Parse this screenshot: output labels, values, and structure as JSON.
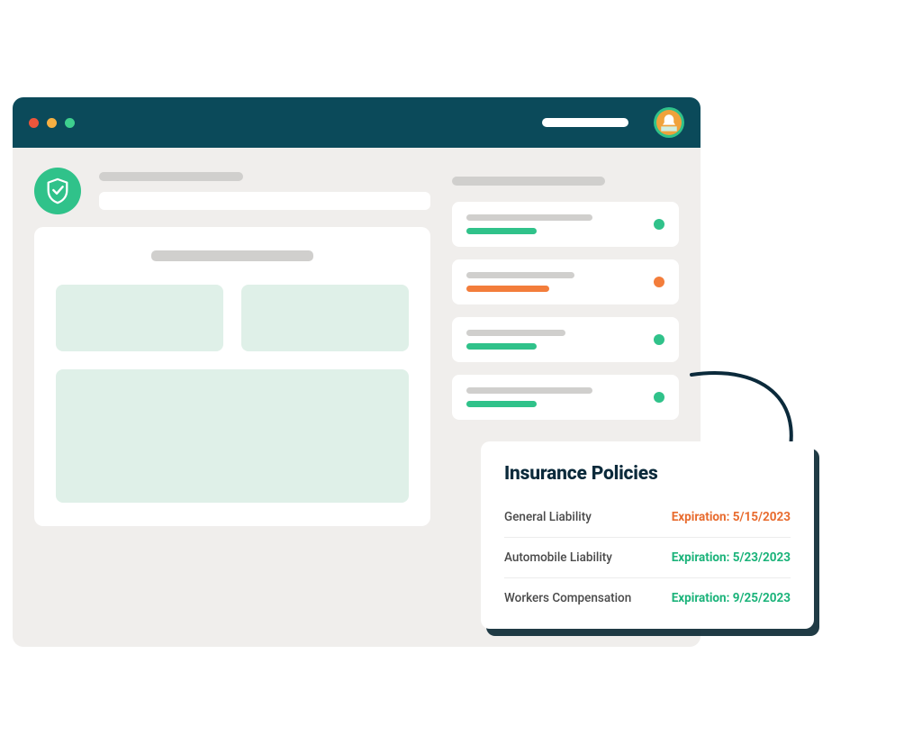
{
  "popover": {
    "title": "Insurance Policies",
    "rows": [
      {
        "name": "General Liability",
        "expiration_label": "Expiration: 5/15/2023",
        "status": "orange"
      },
      {
        "name": "Automobile Liability",
        "expiration_label": "Expiration: 5/23/2023",
        "status": "green"
      },
      {
        "name": "Workers Compensation",
        "expiration_label": "Expiration: 9/25/2023",
        "status": "green"
      }
    ]
  },
  "sidebar_items": [
    {
      "status": "green"
    },
    {
      "status": "orange"
    },
    {
      "status": "green"
    },
    {
      "status": "green"
    }
  ],
  "colors": {
    "titlebar": "#0b4a5a",
    "accent_green": "#30c28a",
    "accent_orange": "#f37d3b",
    "status_ok": "#1bb37a",
    "status_warn": "#e86b2e"
  }
}
